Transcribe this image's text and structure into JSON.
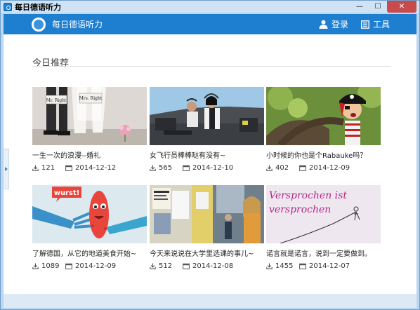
{
  "window": {
    "title": "每日德语听力",
    "close_glyph": "✕",
    "minimize_glyph": "—",
    "maximize_glyph": "☐"
  },
  "header": {
    "app_name": "每日德语听力",
    "login_label": "登录",
    "tools_label": "工具",
    "accent": "#1e7fd0"
  },
  "section": {
    "title": "今日推荐"
  },
  "cards": [
    {
      "title": "一生一次的浪漫--婚礼",
      "downloads": "121",
      "date": "2014-12-12"
    },
    {
      "title": "女飞行员棒棒哒有没有~",
      "downloads": "565",
      "date": "2014-12-10"
    },
    {
      "title": "小时候的你也是个Rabauke吗？",
      "downloads": "402",
      "date": "2014-12-09"
    },
    {
      "title": "了解德国，从它的地道美食开始~",
      "downloads": "1089",
      "date": "2014-12-09"
    },
    {
      "title": "今天来说说在大学里选课的事儿~",
      "downloads": "512",
      "date": "2014-12-08"
    },
    {
      "title": "诺言就是诺言，说到一定要做到。",
      "downloads": "1455",
      "date": "2014-12-07"
    }
  ],
  "thumb_text": {
    "wedding_sign_1": "Mr. Right",
    "wedding_sign_2": "Mrs. Right",
    "wurst": "wurst!",
    "promise_line_1": "Versprochen ist",
    "promise_line_2": "versprochen"
  }
}
